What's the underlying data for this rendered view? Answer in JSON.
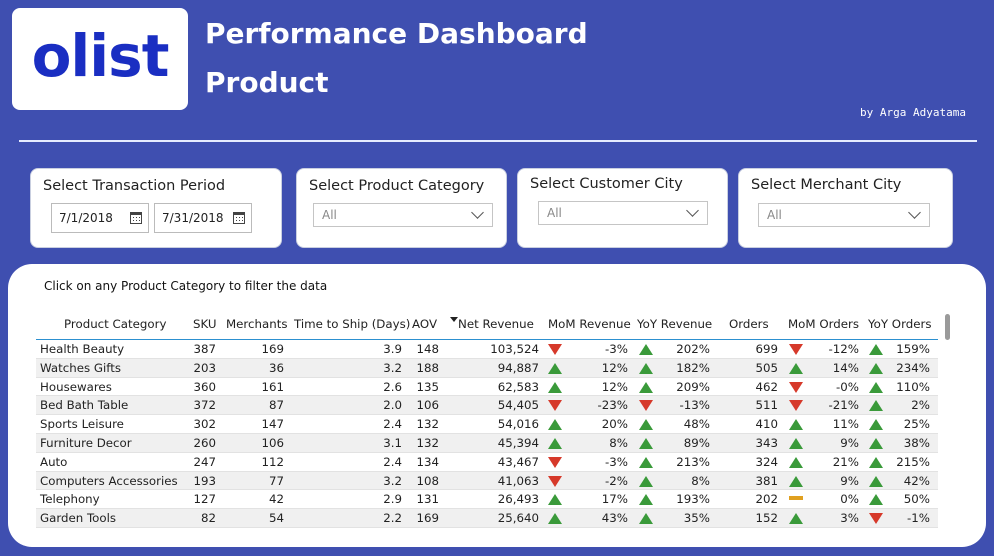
{
  "brand": {
    "logo_text": "olist"
  },
  "header": {
    "title": "Performance Dashboard",
    "subtitle": "Product",
    "byline": "by Arga Adyatama"
  },
  "filters": {
    "period": {
      "title": "Select Transaction Period",
      "start": "7/1/2018",
      "end": "7/31/2018"
    },
    "category": {
      "title": "Select Product Category",
      "value": "All"
    },
    "customer_city": {
      "title": "Select Customer City",
      "value": "All"
    },
    "merchant_city": {
      "title": "Select Merchant City",
      "value": "All"
    }
  },
  "table": {
    "hint": "Click on any Product Category to filter the data",
    "columns": [
      "Product Category",
      "SKU",
      "Merchants",
      "Time to Ship (Days)",
      "AOV",
      "Net Revenue",
      "MoM Revenue",
      "YoY Revenue",
      "Orders",
      "MoM Orders",
      "YoY Orders"
    ],
    "sorted_column": "Net Revenue",
    "rows": [
      {
        "category": "Health Beauty",
        "sku": "387",
        "merchants": "169",
        "ship": "3.9",
        "aov": "148",
        "revenue": "103,524",
        "mom_rev": "-3%",
        "mom_rev_dir": "down",
        "yoy_rev": "202%",
        "yoy_rev_dir": "up",
        "orders": "699",
        "mom_ord": "-12%",
        "mom_ord_dir": "down",
        "yoy_ord": "159%",
        "yoy_ord_dir": "up"
      },
      {
        "category": "Watches Gifts",
        "sku": "203",
        "merchants": "36",
        "ship": "3.2",
        "aov": "188",
        "revenue": "94,887",
        "mom_rev": "12%",
        "mom_rev_dir": "up",
        "yoy_rev": "182%",
        "yoy_rev_dir": "up",
        "orders": "505",
        "mom_ord": "14%",
        "mom_ord_dir": "up",
        "yoy_ord": "234%",
        "yoy_ord_dir": "up"
      },
      {
        "category": "Housewares",
        "sku": "360",
        "merchants": "161",
        "ship": "2.6",
        "aov": "135",
        "revenue": "62,583",
        "mom_rev": "12%",
        "mom_rev_dir": "up",
        "yoy_rev": "209%",
        "yoy_rev_dir": "up",
        "orders": "462",
        "mom_ord": "-0%",
        "mom_ord_dir": "down",
        "yoy_ord": "110%",
        "yoy_ord_dir": "up"
      },
      {
        "category": "Bed Bath Table",
        "sku": "372",
        "merchants": "87",
        "ship": "2.0",
        "aov": "106",
        "revenue": "54,405",
        "mom_rev": "-23%",
        "mom_rev_dir": "down",
        "yoy_rev": "-13%",
        "yoy_rev_dir": "down",
        "orders": "511",
        "mom_ord": "-21%",
        "mom_ord_dir": "down",
        "yoy_ord": "2%",
        "yoy_ord_dir": "up"
      },
      {
        "category": "Sports Leisure",
        "sku": "302",
        "merchants": "147",
        "ship": "2.4",
        "aov": "132",
        "revenue": "54,016",
        "mom_rev": "20%",
        "mom_rev_dir": "up",
        "yoy_rev": "48%",
        "yoy_rev_dir": "up",
        "orders": "410",
        "mom_ord": "11%",
        "mom_ord_dir": "up",
        "yoy_ord": "25%",
        "yoy_ord_dir": "up"
      },
      {
        "category": "Furniture Decor",
        "sku": "260",
        "merchants": "106",
        "ship": "3.1",
        "aov": "132",
        "revenue": "45,394",
        "mom_rev": "8%",
        "mom_rev_dir": "up",
        "yoy_rev": "89%",
        "yoy_rev_dir": "up",
        "orders": "343",
        "mom_ord": "9%",
        "mom_ord_dir": "up",
        "yoy_ord": "38%",
        "yoy_ord_dir": "up"
      },
      {
        "category": "Auto",
        "sku": "247",
        "merchants": "112",
        "ship": "2.4",
        "aov": "134",
        "revenue": "43,467",
        "mom_rev": "-3%",
        "mom_rev_dir": "down",
        "yoy_rev": "213%",
        "yoy_rev_dir": "up",
        "orders": "324",
        "mom_ord": "21%",
        "mom_ord_dir": "up",
        "yoy_ord": "215%",
        "yoy_ord_dir": "up"
      },
      {
        "category": "Computers Accessories",
        "sku": "193",
        "merchants": "77",
        "ship": "3.2",
        "aov": "108",
        "revenue": "41,063",
        "mom_rev": "-2%",
        "mom_rev_dir": "down",
        "yoy_rev": "8%",
        "yoy_rev_dir": "up",
        "orders": "381",
        "mom_ord": "9%",
        "mom_ord_dir": "up",
        "yoy_ord": "42%",
        "yoy_ord_dir": "up"
      },
      {
        "category": "Telephony",
        "sku": "127",
        "merchants": "42",
        "ship": "2.9",
        "aov": "131",
        "revenue": "26,493",
        "mom_rev": "17%",
        "mom_rev_dir": "up",
        "yoy_rev": "193%",
        "yoy_rev_dir": "up",
        "orders": "202",
        "mom_ord": "0%",
        "mom_ord_dir": "flat",
        "yoy_ord": "50%",
        "yoy_ord_dir": "up"
      },
      {
        "category": "Garden Tools",
        "sku": "82",
        "merchants": "54",
        "ship": "2.2",
        "aov": "169",
        "revenue": "25,640",
        "mom_rev": "43%",
        "mom_rev_dir": "up",
        "yoy_rev": "35%",
        "yoy_rev_dir": "up",
        "orders": "152",
        "mom_ord": "3%",
        "mom_ord_dir": "up",
        "yoy_ord": "-1%",
        "yoy_ord_dir": "down"
      }
    ]
  },
  "colors": {
    "background": "#3f4fb0",
    "logo": "#1a2ec2",
    "up": "#3a9a3a",
    "down": "#d6392a",
    "flat": "#e0a020"
  }
}
